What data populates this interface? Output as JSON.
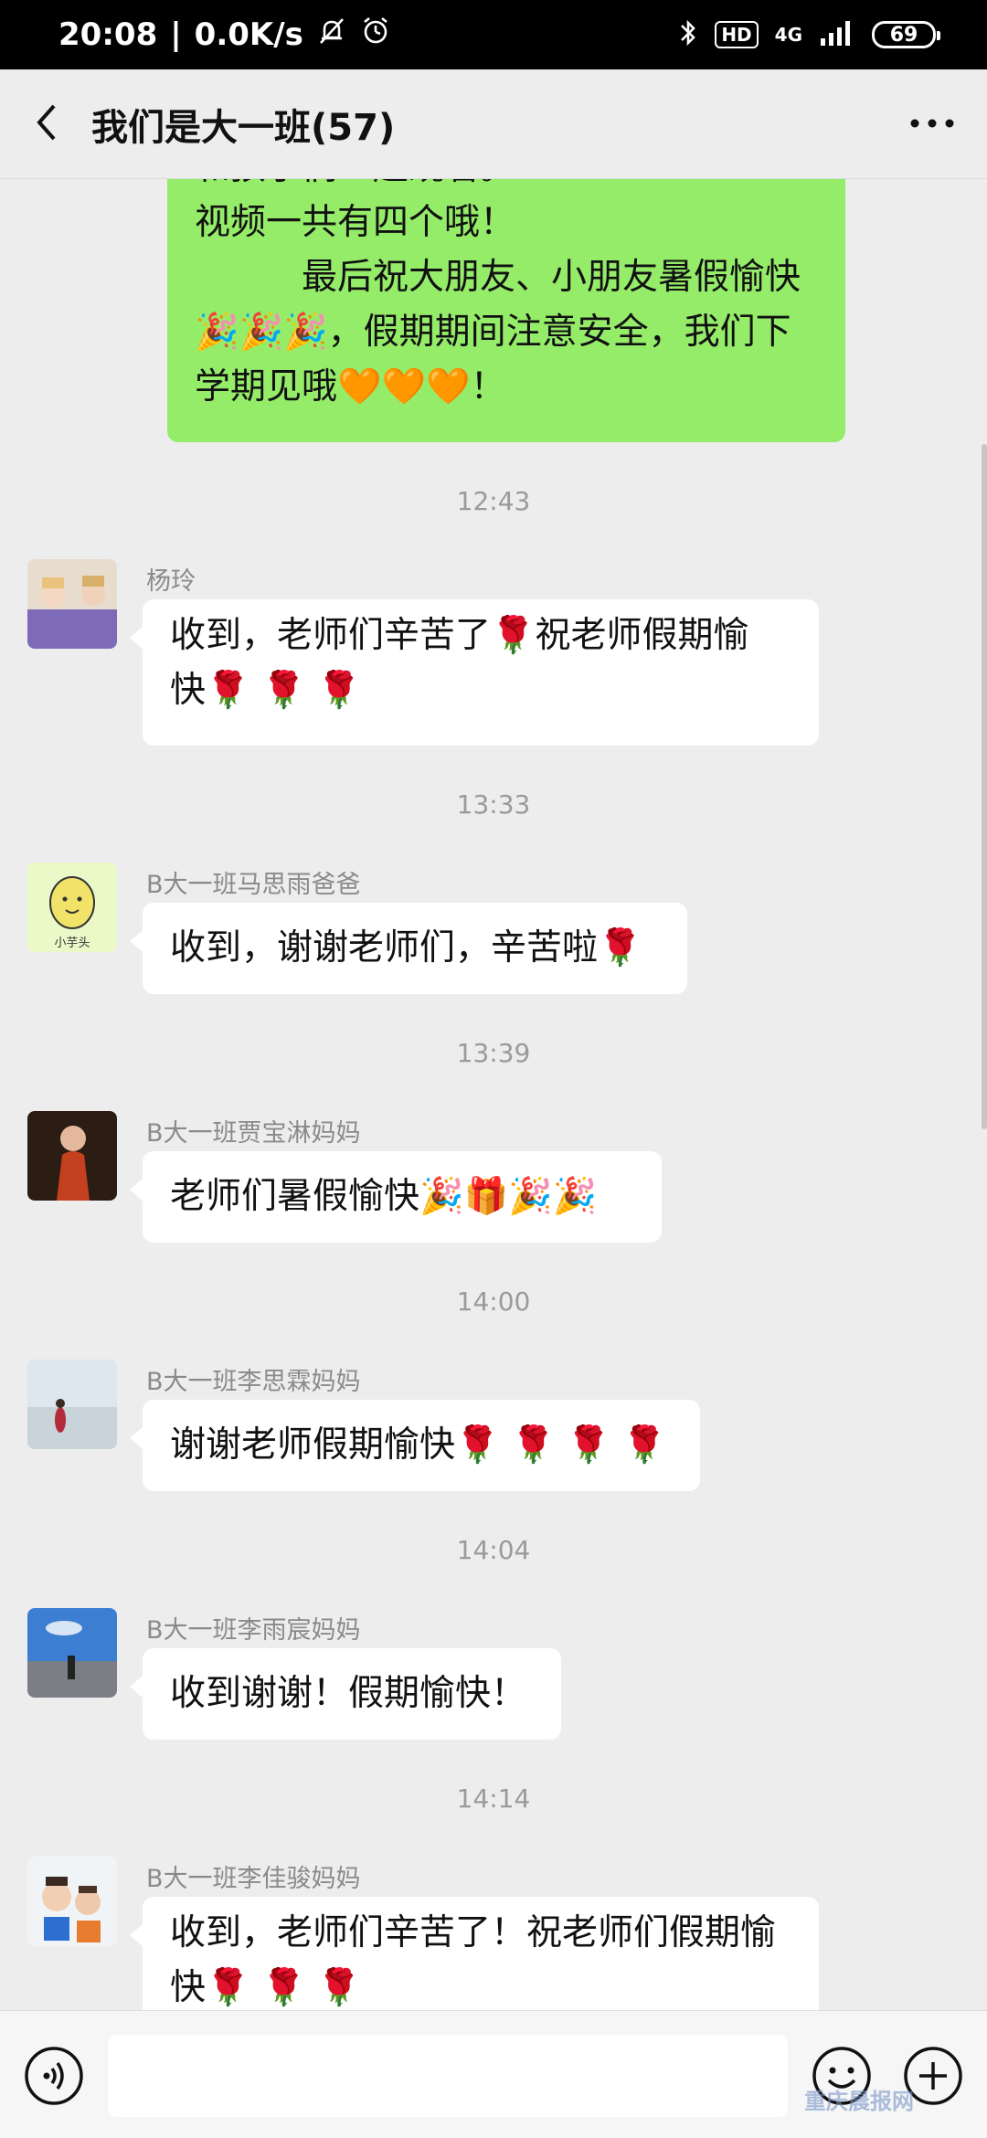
{
  "status_bar": {
    "time": "20:08",
    "net_speed": "0.0K/s",
    "hd": "HD",
    "network": "4G",
    "battery": "69"
  },
  "header": {
    "title": "我们是大一班(57)"
  },
  "messages": {
    "top_lines": [
      "和孩子们一起观看。",
      "视频一共有四个哦！",
      "　　　最后祝大朋友、小朋友暑假愉快",
      "🎉🎉🎉，假期期间注意安全，我们下",
      "学期见哦🧡🧡🧡！"
    ],
    "times": [
      "12:43",
      "13:33",
      "13:39",
      "14:00",
      "14:04",
      "14:14"
    ],
    "m1": {
      "sender": "杨玲",
      "line1": "收到，老师们辛苦了🌹祝老师假期愉",
      "line2": "快🌹 🌹 🌹"
    },
    "m2": {
      "sender": "B大一班马思雨爸爸",
      "text": "收到，谢谢老师们，辛苦啦🌹"
    },
    "m3": {
      "sender": "B大一班贾宝淋妈妈",
      "text": "老师们暑假愉快🎉🎁🎉🎉"
    },
    "m4": {
      "sender": "B大一班李思霖妈妈",
      "text": "谢谢老师假期愉快🌹 🌹 🌹 🌹"
    },
    "m5": {
      "sender": "B大一班李雨宸妈妈",
      "text": "收到谢谢！假期愉快！"
    },
    "m6": {
      "sender": "B大一班李佳骏妈妈",
      "line1": "收到，老师们辛苦了！祝老师们假期愉",
      "line2": "快🌹 🌹 🌹"
    }
  },
  "avatar_icons": [
    "avatar-photo-icon",
    "smiling-potato-icon",
    "avatar-photo-icon",
    "avatar-photo-icon",
    "avatar-photo-icon",
    "avatar-photo-icon"
  ],
  "avatar_caption": "小芋头",
  "icons": {
    "back": "back-arrow-icon",
    "more": "more-dots-icon",
    "voice": "voice-icon",
    "emoji": "emoji-icon",
    "plus": "plus-icon"
  },
  "colors": {
    "sent_bubble": "#95ec69",
    "received_bubble": "#ffffff",
    "chat_bg": "#ededed"
  },
  "watermark": "重庆晨报网"
}
